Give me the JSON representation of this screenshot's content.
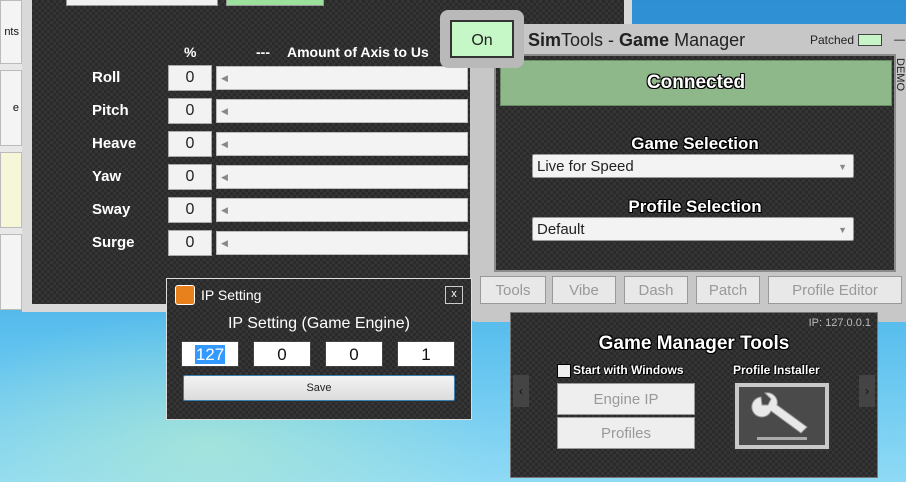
{
  "left_strip": {
    "items": [
      "nts",
      "e"
    ]
  },
  "axis_window": {
    "headers": {
      "percent": "%",
      "dashes": "---",
      "amount": "Amount of Axis to Us"
    },
    "rows": [
      {
        "label": "Roll",
        "value": "0"
      },
      {
        "label": "Pitch",
        "value": "0"
      },
      {
        "label": "Heave",
        "value": "0"
      },
      {
        "label": "Yaw",
        "value": "0"
      },
      {
        "label": "Sway",
        "value": "0"
      },
      {
        "label": "Surge",
        "value": "0"
      }
    ]
  },
  "game_manager": {
    "title_sim": "Sim",
    "title_tools": "Tools",
    "title_sep": " - ",
    "title_game": "Game",
    "title_manager": " Manager",
    "patched_label": "Patched",
    "demo_label": "DEMO",
    "on_button": "On",
    "status": "Connected",
    "game_selection_label": "Game Selection",
    "game_selection_value": "Live for Speed",
    "profile_selection_label": "Profile Selection",
    "profile_selection_value": "Default",
    "tabs": [
      "Tools",
      "Vibe",
      "Dash",
      "Patch",
      "Profile Editor"
    ]
  },
  "tools_panel": {
    "ip_label": "IP: 127.0.0.1",
    "title": "Game Manager Tools",
    "start_with_windows": "Start with Windows",
    "profile_installer": "Profile Installer",
    "engine_ip_button": "Engine IP",
    "profiles_button": "Profiles"
  },
  "ip_dialog": {
    "title": "IP Setting",
    "heading": "IP Setting (Game Engine)",
    "octets": [
      "127",
      "0",
      "0",
      "1"
    ],
    "save": "Save",
    "close": "x"
  }
}
